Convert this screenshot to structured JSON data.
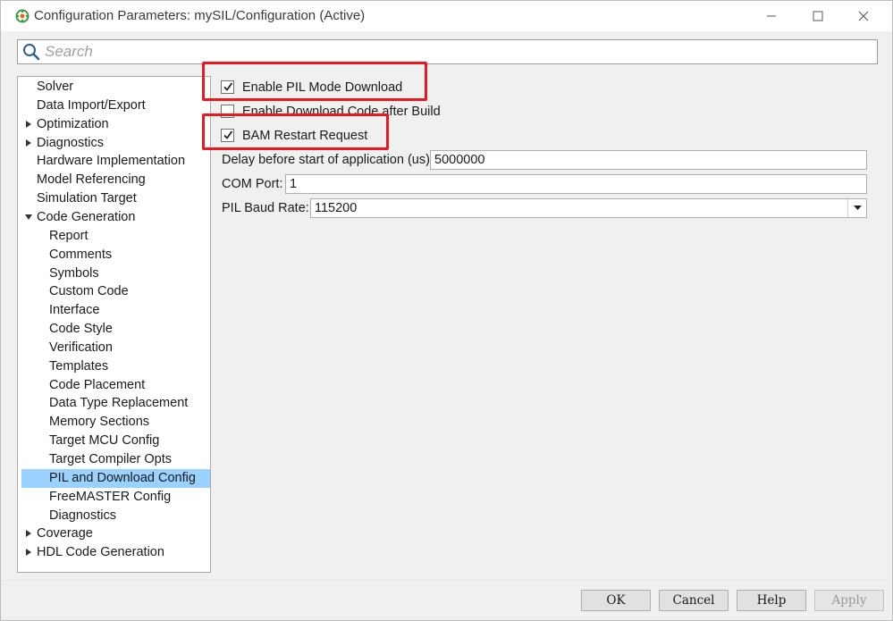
{
  "window": {
    "title": "Configuration Parameters: mySIL/Configuration (Active)",
    "accent": "#e8191f"
  },
  "search": {
    "placeholder": "Search",
    "value": ""
  },
  "tree": {
    "items": [
      {
        "label": "Solver",
        "expandable": false
      },
      {
        "label": "Data Import/Export",
        "expandable": false
      },
      {
        "label": "Optimization",
        "expandable": true,
        "expanded": false
      },
      {
        "label": "Diagnostics",
        "expandable": true,
        "expanded": false
      },
      {
        "label": "Hardware Implementation",
        "expandable": false
      },
      {
        "label": "Model Referencing",
        "expandable": false
      },
      {
        "label": "Simulation Target",
        "expandable": false
      },
      {
        "label": "Code Generation",
        "expandable": true,
        "expanded": true
      },
      {
        "label": "Report",
        "child": true
      },
      {
        "label": "Comments",
        "child": true
      },
      {
        "label": "Symbols",
        "child": true
      },
      {
        "label": "Custom Code",
        "child": true
      },
      {
        "label": "Interface",
        "child": true
      },
      {
        "label": "Code Style",
        "child": true
      },
      {
        "label": "Verification",
        "child": true
      },
      {
        "label": "Templates",
        "child": true
      },
      {
        "label": "Code Placement",
        "child": true
      },
      {
        "label": "Data Type Replacement",
        "child": true
      },
      {
        "label": "Memory Sections",
        "child": true
      },
      {
        "label": "Target MCU Config",
        "child": true
      },
      {
        "label": "Target Compiler Opts",
        "child": true
      },
      {
        "label": "PIL and Download Config",
        "child": true,
        "selected": true
      },
      {
        "label": "FreeMASTER Config",
        "child": true
      },
      {
        "label": "Diagnostics",
        "child": true
      },
      {
        "label": "Coverage",
        "expandable": true,
        "expanded": false
      },
      {
        "label": "HDL Code Generation",
        "expandable": true,
        "expanded": false
      }
    ]
  },
  "panel": {
    "enable_pil": {
      "label": "Enable PIL Mode Download",
      "checked": true
    },
    "enable_download": {
      "label": "Enable Download Code after Build",
      "checked": false
    },
    "bam_restart": {
      "label": "BAM Restart Request",
      "checked": true
    },
    "delay": {
      "label": "Delay before start of application (us):",
      "value": "5000000"
    },
    "com_port": {
      "label": "COM Port:",
      "value": "1"
    },
    "baud": {
      "label": "PIL Baud Rate:",
      "value": "115200"
    }
  },
  "buttons": {
    "ok": "OK",
    "cancel": "Cancel",
    "help": "Help",
    "apply": "Apply"
  }
}
